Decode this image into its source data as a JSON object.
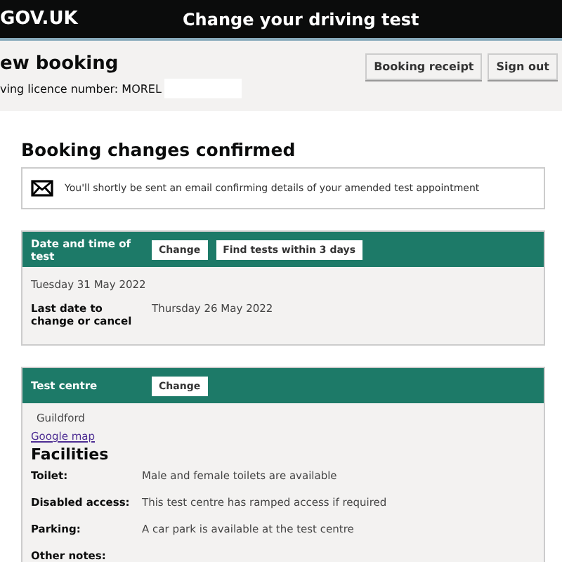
{
  "header": {
    "logo": "GOV.UK",
    "title": "Change your driving test"
  },
  "booking": {
    "title": "ew booking",
    "licence": "ving licence number: MOREL",
    "buttons": [
      "Booking receipt",
      "Sign out"
    ]
  },
  "confirmation": {
    "heading": "Booking changes confirmed",
    "message": "You'll shortly be sent an email confirming details of your amended test appointment"
  },
  "date_panel": {
    "title": "Date and time of test",
    "buttons": [
      "Change",
      "Find tests within 3 days"
    ],
    "test_date": "Tuesday 31 May 2022",
    "deadline_label": "Last date to change or cancel",
    "deadline_value": "Thursday 26 May 2022"
  },
  "centre_panel": {
    "title": "Test centre",
    "buttons": [
      "Change"
    ],
    "name": "Guildford",
    "map_link": "Google map",
    "facilities_heading": "Facilities",
    "facilities": [
      {
        "label": "Toilet:",
        "value": "Male and female toilets are available"
      },
      {
        "label": "Disabled access:",
        "value": "This test centre has ramped access if required"
      },
      {
        "label": "Parking:",
        "value": "A car park is available at the test centre"
      },
      {
        "label": "Other notes:"
      }
    ]
  }
}
